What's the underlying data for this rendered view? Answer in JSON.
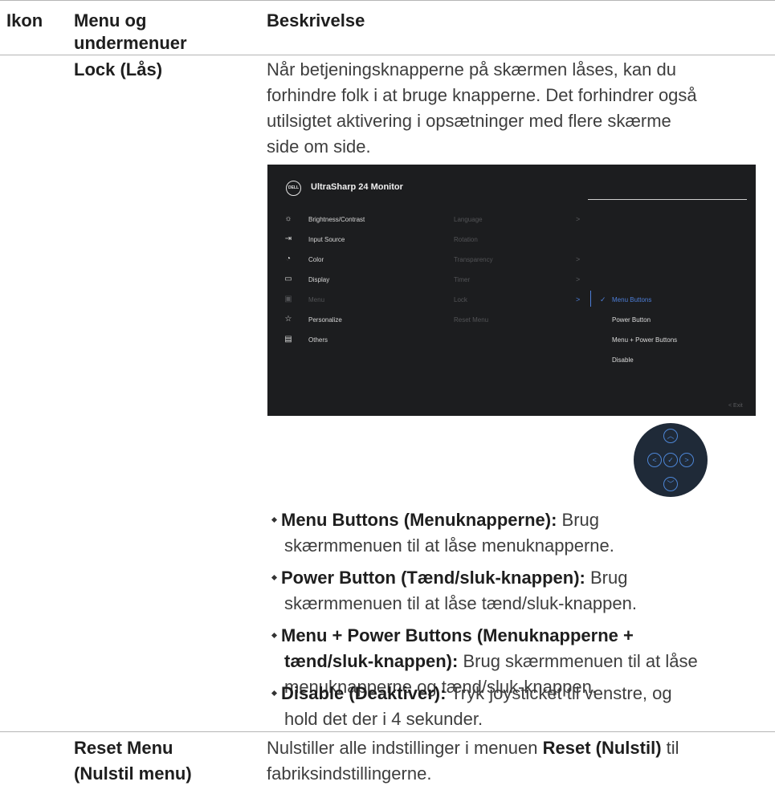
{
  "header": {
    "col_icon": "Ikon",
    "col_menu_line1": "Menu og",
    "col_menu_line2": "undermenuer",
    "col_desc": "Beskrivelse"
  },
  "lock": {
    "label": "Lock (Lås)",
    "description_lines": [
      "Når betjeningsknapperne på skærmen låses, kan du",
      "forhindre folk i at bruge knapperne. Det forhindrer også",
      "utilsigtet aktivering i opsætninger med flere skærme",
      "side om side."
    ]
  },
  "osd": {
    "logo": "DELL",
    "title": "UltraSharp 24 Monitor",
    "menu": [
      {
        "label": "Brightness/Contrast",
        "icon": "brightness-icon",
        "glyph": "☼"
      },
      {
        "label": "Input Source",
        "icon": "input-source-icon",
        "glyph": "⇥"
      },
      {
        "label": "Color",
        "icon": "color-icon",
        "glyph": "◔"
      },
      {
        "label": "Display",
        "icon": "display-icon",
        "glyph": "▭"
      },
      {
        "label": "Menu",
        "icon": "menu-icon",
        "glyph": "▣"
      },
      {
        "label": "Personalize",
        "icon": "star-icon",
        "glyph": "☆"
      },
      {
        "label": "Others",
        "icon": "others-icon",
        "glyph": "▤"
      }
    ],
    "submenu": [
      {
        "label": "Language",
        "chevron": ">"
      },
      {
        "label": "Rotation",
        "chevron": ""
      },
      {
        "label": "Transparency",
        "chevron": ">"
      },
      {
        "label": "Timer",
        "chevron": ">"
      },
      {
        "label": "Lock",
        "chevron": ">"
      },
      {
        "label": "Reset Menu",
        "chevron": ""
      }
    ],
    "options": [
      "Menu Buttons",
      "Power Button",
      "Menu + Power Buttons",
      "Disable"
    ],
    "check_glyph": "✓",
    "exit_label": "<  Exit",
    "accent_color": "#4d7ed8"
  },
  "joystick": {
    "up": "︿",
    "down": "﹀",
    "left": "<",
    "right": ">",
    "center": "✓"
  },
  "bullets": {
    "b1_bold": "Menu Buttons (Menuknapperne):",
    "b1_text": " Brug",
    "b1_cont": "skærmmenuen til at låse menuknapperne.",
    "b2_bold": "Power Button (Tænd/sluk-knappen):",
    "b2_text": " Brug",
    "b2_cont": "skærmmenuen til at låse tænd/sluk-knappen.",
    "b3_bold": "Menu + Power Buttons (Menuknapperne +",
    "b3_bold2": "tænd/sluk-knappen):",
    "b3_text": " Brug skærmmenuen til at låse",
    "b3_cont": "menuknapperne og tænd/sluk-knappen.",
    "b4_bold": "Disable (Deaktiver):",
    "b4_text": " Tryk joysticket til venstre, og",
    "b4_cont": "hold det der i 4 sekunder."
  },
  "reset": {
    "label_line1": "Reset Menu",
    "label_line2": "(Nulstil menu)",
    "desc_pre": "Nulstiller alle indstillinger i menuen ",
    "desc_bold": "Reset (Nulstil)",
    "desc_post": " til",
    "desc_line2": "fabriksindstillingerne."
  }
}
